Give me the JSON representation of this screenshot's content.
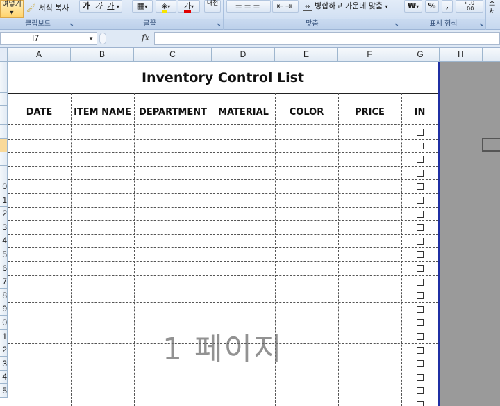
{
  "ribbon": {
    "clipboard": {
      "paste_label": "여넣기",
      "format_painter_label": "서식 복사",
      "group_label": "클립보드"
    },
    "font": {
      "bold_label": "가",
      "italic_label": "가",
      "underline_label": "가",
      "font_color_letter": "가",
      "group_label": "글꼴"
    },
    "alignment": {
      "phonetic_label": "내천",
      "merge_center_label": "병합하고 가운데 맞춤",
      "group_label": "맞춤"
    },
    "number": {
      "currency_label": "₩",
      "percent_label": "%",
      "comma_label": ",",
      "group_label": "표시 형식"
    },
    "styles": {
      "partial_label": "소서"
    }
  },
  "formula_bar": {
    "name_box": "I7",
    "fx_label": "fx",
    "formula": ""
  },
  "columns": [
    "A",
    "B",
    "C",
    "D",
    "E",
    "F",
    "G",
    "H"
  ],
  "row_numbers": [
    "",
    "",
    "",
    "",
    "0",
    "1",
    "2",
    "3",
    "4",
    "5",
    "6",
    "7",
    "8",
    "9",
    "0",
    "1",
    "2",
    "3",
    "4",
    "5"
  ],
  "sheet": {
    "title": "Inventory Control List",
    "headers": [
      "DATE",
      "ITEM NAME",
      "DEPARTMENT",
      "MATERIAL",
      "COLOR",
      "PRICE",
      "IN"
    ],
    "page_watermark": "1 페이지"
  },
  "colors": {
    "page_break_blue": "#1f2fa3",
    "ribbon_bg": "#d4e2f4",
    "selected_row": "#f9d999",
    "gray_area": "#9a9a9a"
  }
}
